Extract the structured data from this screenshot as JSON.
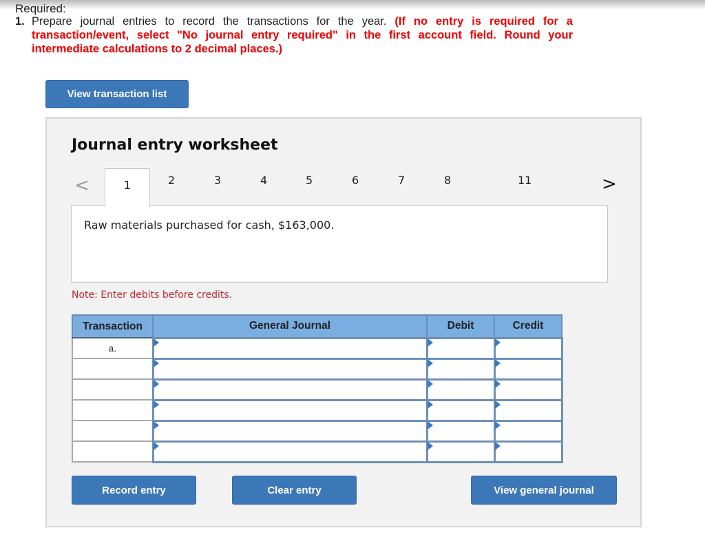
{
  "header": {
    "required_label": "Required:",
    "instruction_number": "1.",
    "instruction_text": "Prepare journal entries to record the transactions for the year.",
    "instruction_note": "(If no entry is required for a transaction/event, select \"No journal entry required\" in the first account field. Round your intermediate calculations to 2 decimal places.)"
  },
  "buttons": {
    "view_transaction_list": "View transaction list",
    "record_entry": "Record entry",
    "clear_entry": "Clear entry",
    "view_general_journal": "View general journal"
  },
  "worksheet": {
    "title": "Journal entry worksheet",
    "tabs": [
      "1",
      "2",
      "3",
      "4",
      "5",
      "6",
      "7",
      "8",
      "11"
    ],
    "active_tab": "1",
    "description": "Raw materials purchased for cash, $163,000.",
    "note": "Note: Enter debits before credits.",
    "table": {
      "headers": [
        "Transaction",
        "General Journal",
        "Debit",
        "Credit"
      ],
      "rows": [
        {
          "transaction": "a.",
          "account": "",
          "debit": "",
          "credit": ""
        },
        {
          "transaction": "",
          "account": "",
          "debit": "",
          "credit": ""
        },
        {
          "transaction": "",
          "account": "",
          "debit": "",
          "credit": ""
        },
        {
          "transaction": "",
          "account": "",
          "debit": "",
          "credit": ""
        },
        {
          "transaction": "",
          "account": "",
          "debit": "",
          "credit": ""
        },
        {
          "transaction": "",
          "account": "",
          "debit": "",
          "credit": ""
        }
      ]
    }
  },
  "colors": {
    "button_blue": "#3c77b8",
    "header_blue": "#7aaee0",
    "instruction_red": "#ee0000",
    "note_red": "#c0282c"
  }
}
